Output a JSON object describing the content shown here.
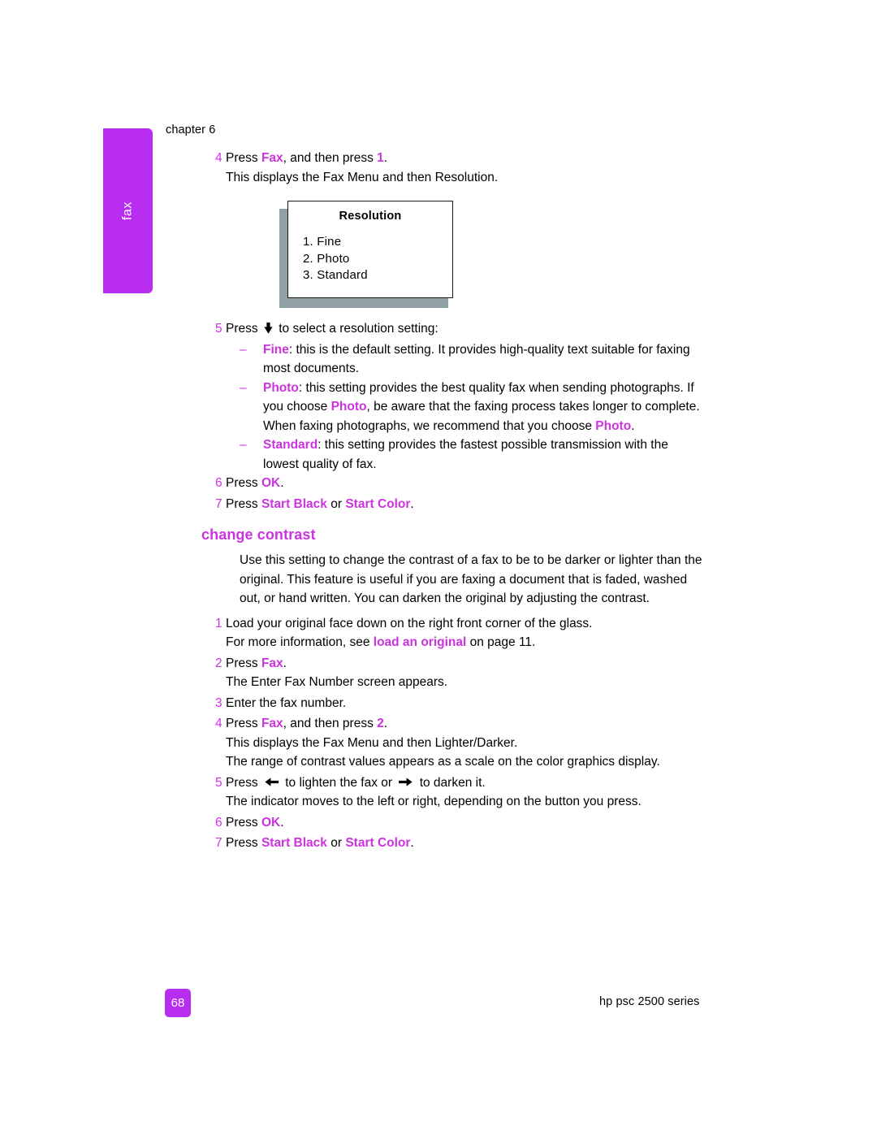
{
  "page": {
    "running_head": "chapter 6",
    "side_tab_label": "fax",
    "page_number": "68",
    "product_footer": "hp psc 2500 series",
    "accent_color": "#cc33e0",
    "tab_color": "#b92df0",
    "figure_shadow_color": "#8fa1a3"
  },
  "resolution_section": {
    "steps": [
      {
        "number": "4",
        "lines": [
          {
            "parts": [
              {
                "t": "Press ",
                "s": "plain"
              },
              {
                "t": "Fax",
                "s": "kw"
              },
              {
                "t": ", and then press ",
                "s": "plain"
              },
              {
                "t": "1",
                "s": "kw"
              },
              {
                "t": ".",
                "s": "plain"
              }
            ]
          },
          {
            "parts": [
              {
                "t": "This displays the Fax Menu and then Resolution.",
                "s": "plain"
              }
            ]
          }
        ]
      }
    ],
    "figure": {
      "title": "Resolution",
      "options": [
        "1. Fine",
        "2. Photo",
        "3. Standard"
      ]
    },
    "step5": {
      "number": "5",
      "intro_before": "Press ",
      "intro_icon": "arrow-down-icon",
      "intro_after": " to select a resolution setting:",
      "bullets": [
        {
          "mark": "–",
          "parts": [
            {
              "t": "Fine",
              "s": "kw"
            },
            {
              "t": ": this is the default setting. It provides high-quality text suitable for faxing most documents.",
              "s": "plain"
            }
          ]
        },
        {
          "mark": "–",
          "parts": [
            {
              "t": "Photo",
              "s": "kw"
            },
            {
              "t": ": this setting provides the best quality fax when sending photographs. If you choose ",
              "s": "plain"
            },
            {
              "t": "Photo",
              "s": "kw"
            },
            {
              "t": ", be aware that the faxing process takes longer to complete. When faxing photographs, we recommend that you choose ",
              "s": "plain"
            },
            {
              "t": "Photo",
              "s": "kw"
            },
            {
              "t": ".",
              "s": "plain"
            }
          ]
        },
        {
          "mark": "–",
          "parts": [
            {
              "t": "Standard",
              "s": "kw"
            },
            {
              "t": ": this setting provides the fastest possible transmission with the lowest quality of fax.",
              "s": "plain"
            }
          ]
        }
      ]
    },
    "step6": {
      "number": "6",
      "parts": [
        {
          "t": "Press ",
          "s": "plain"
        },
        {
          "t": "OK",
          "s": "kw"
        },
        {
          "t": ".",
          "s": "plain"
        }
      ]
    },
    "step7": {
      "number": "7",
      "parts": [
        {
          "t": "Press ",
          "s": "plain"
        },
        {
          "t": "Start Black",
          "s": "kw"
        },
        {
          "t": " or ",
          "s": "plain"
        },
        {
          "t": "Start Color",
          "s": "kw"
        },
        {
          "t": ".",
          "s": "plain"
        }
      ]
    }
  },
  "contrast_section": {
    "heading": "change contrast",
    "intro": "Use this setting to change the contrast of a fax to be to be darker or lighter than the original. This feature is useful if you are faxing a document that is faded, washed out, or hand written. You can darken the original by adjusting the contrast.",
    "step1": {
      "number": "1",
      "line1": "Load your original face down on the right front corner of the glass.",
      "line2_before": "For more information, see ",
      "line2_xref": "load an original",
      "line2_after": " on page 11."
    },
    "step2": {
      "number": "2",
      "parts": [
        {
          "t": "Press ",
          "s": "plain"
        },
        {
          "t": "Fax",
          "s": "kw"
        },
        {
          "t": ".",
          "s": "plain"
        }
      ],
      "followup": "The Enter Fax Number screen appears."
    },
    "step3": {
      "number": "3",
      "line": "Enter the fax number."
    },
    "step4": {
      "number": "4",
      "parts": [
        {
          "t": "Press ",
          "s": "plain"
        },
        {
          "t": "Fax",
          "s": "kw"
        },
        {
          "t": ", and then press ",
          "s": "plain"
        },
        {
          "t": "2",
          "s": "kw"
        },
        {
          "t": ".",
          "s": "plain"
        }
      ],
      "followup1": "This displays the Fax Menu and then Lighter/Darker.",
      "followup2": "The range of contrast values appears as a scale on the color graphics display."
    },
    "step5": {
      "number": "5",
      "before": "Press ",
      "icon_left": "arrow-left-icon",
      "middle": " to lighten the fax or ",
      "icon_right": "arrow-right-icon",
      "after": " to darken it.",
      "followup": "The indicator moves to the left or right, depending on the button you press."
    },
    "step6": {
      "number": "6",
      "parts": [
        {
          "t": "Press ",
          "s": "plain"
        },
        {
          "t": "OK",
          "s": "kw"
        },
        {
          "t": ".",
          "s": "plain"
        }
      ]
    },
    "step7": {
      "number": "7",
      "parts": [
        {
          "t": "Press ",
          "s": "plain"
        },
        {
          "t": "Start Black",
          "s": "kw"
        },
        {
          "t": " or ",
          "s": "plain"
        },
        {
          "t": "Start Color",
          "s": "kw"
        },
        {
          "t": ".",
          "s": "plain"
        }
      ]
    }
  }
}
